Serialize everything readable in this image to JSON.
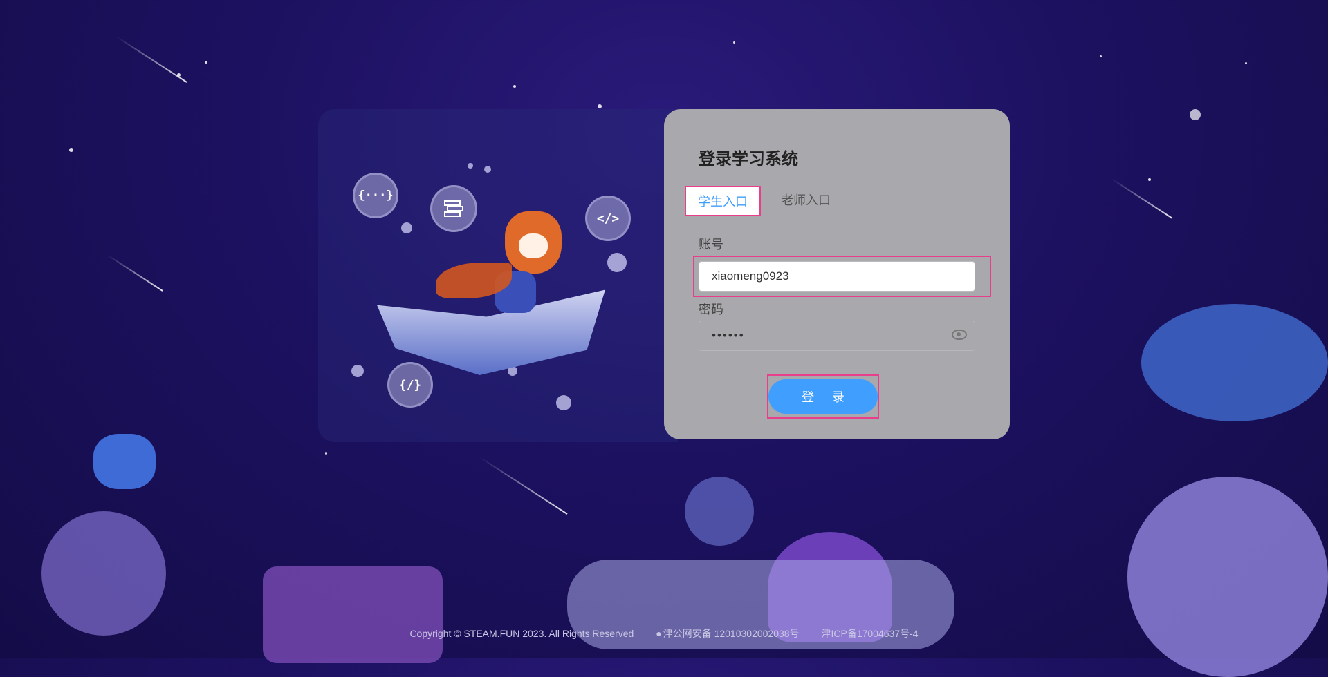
{
  "login": {
    "title": "登录学习系统",
    "tabs": [
      {
        "label": "学生入口",
        "active": true
      },
      {
        "label": "老师入口",
        "active": false
      }
    ],
    "account": {
      "label": "账号",
      "value": "xiaomeng0923"
    },
    "password": {
      "label": "密码",
      "value": "••••••"
    },
    "submit_label": "登 录"
  },
  "illustration": {
    "bubbles": [
      "{···}",
      "</>",
      "{/}"
    ]
  },
  "footer": {
    "copyright": "Copyright © STEAM.FUN 2023. All Rights Reserved",
    "police_record": "津公网安备 12010302002038号",
    "icp_record": "津ICP备17004637号-4"
  },
  "colors": {
    "accent": "#409eff",
    "highlight": "#e83e8c",
    "card": "#a9a9ad"
  }
}
